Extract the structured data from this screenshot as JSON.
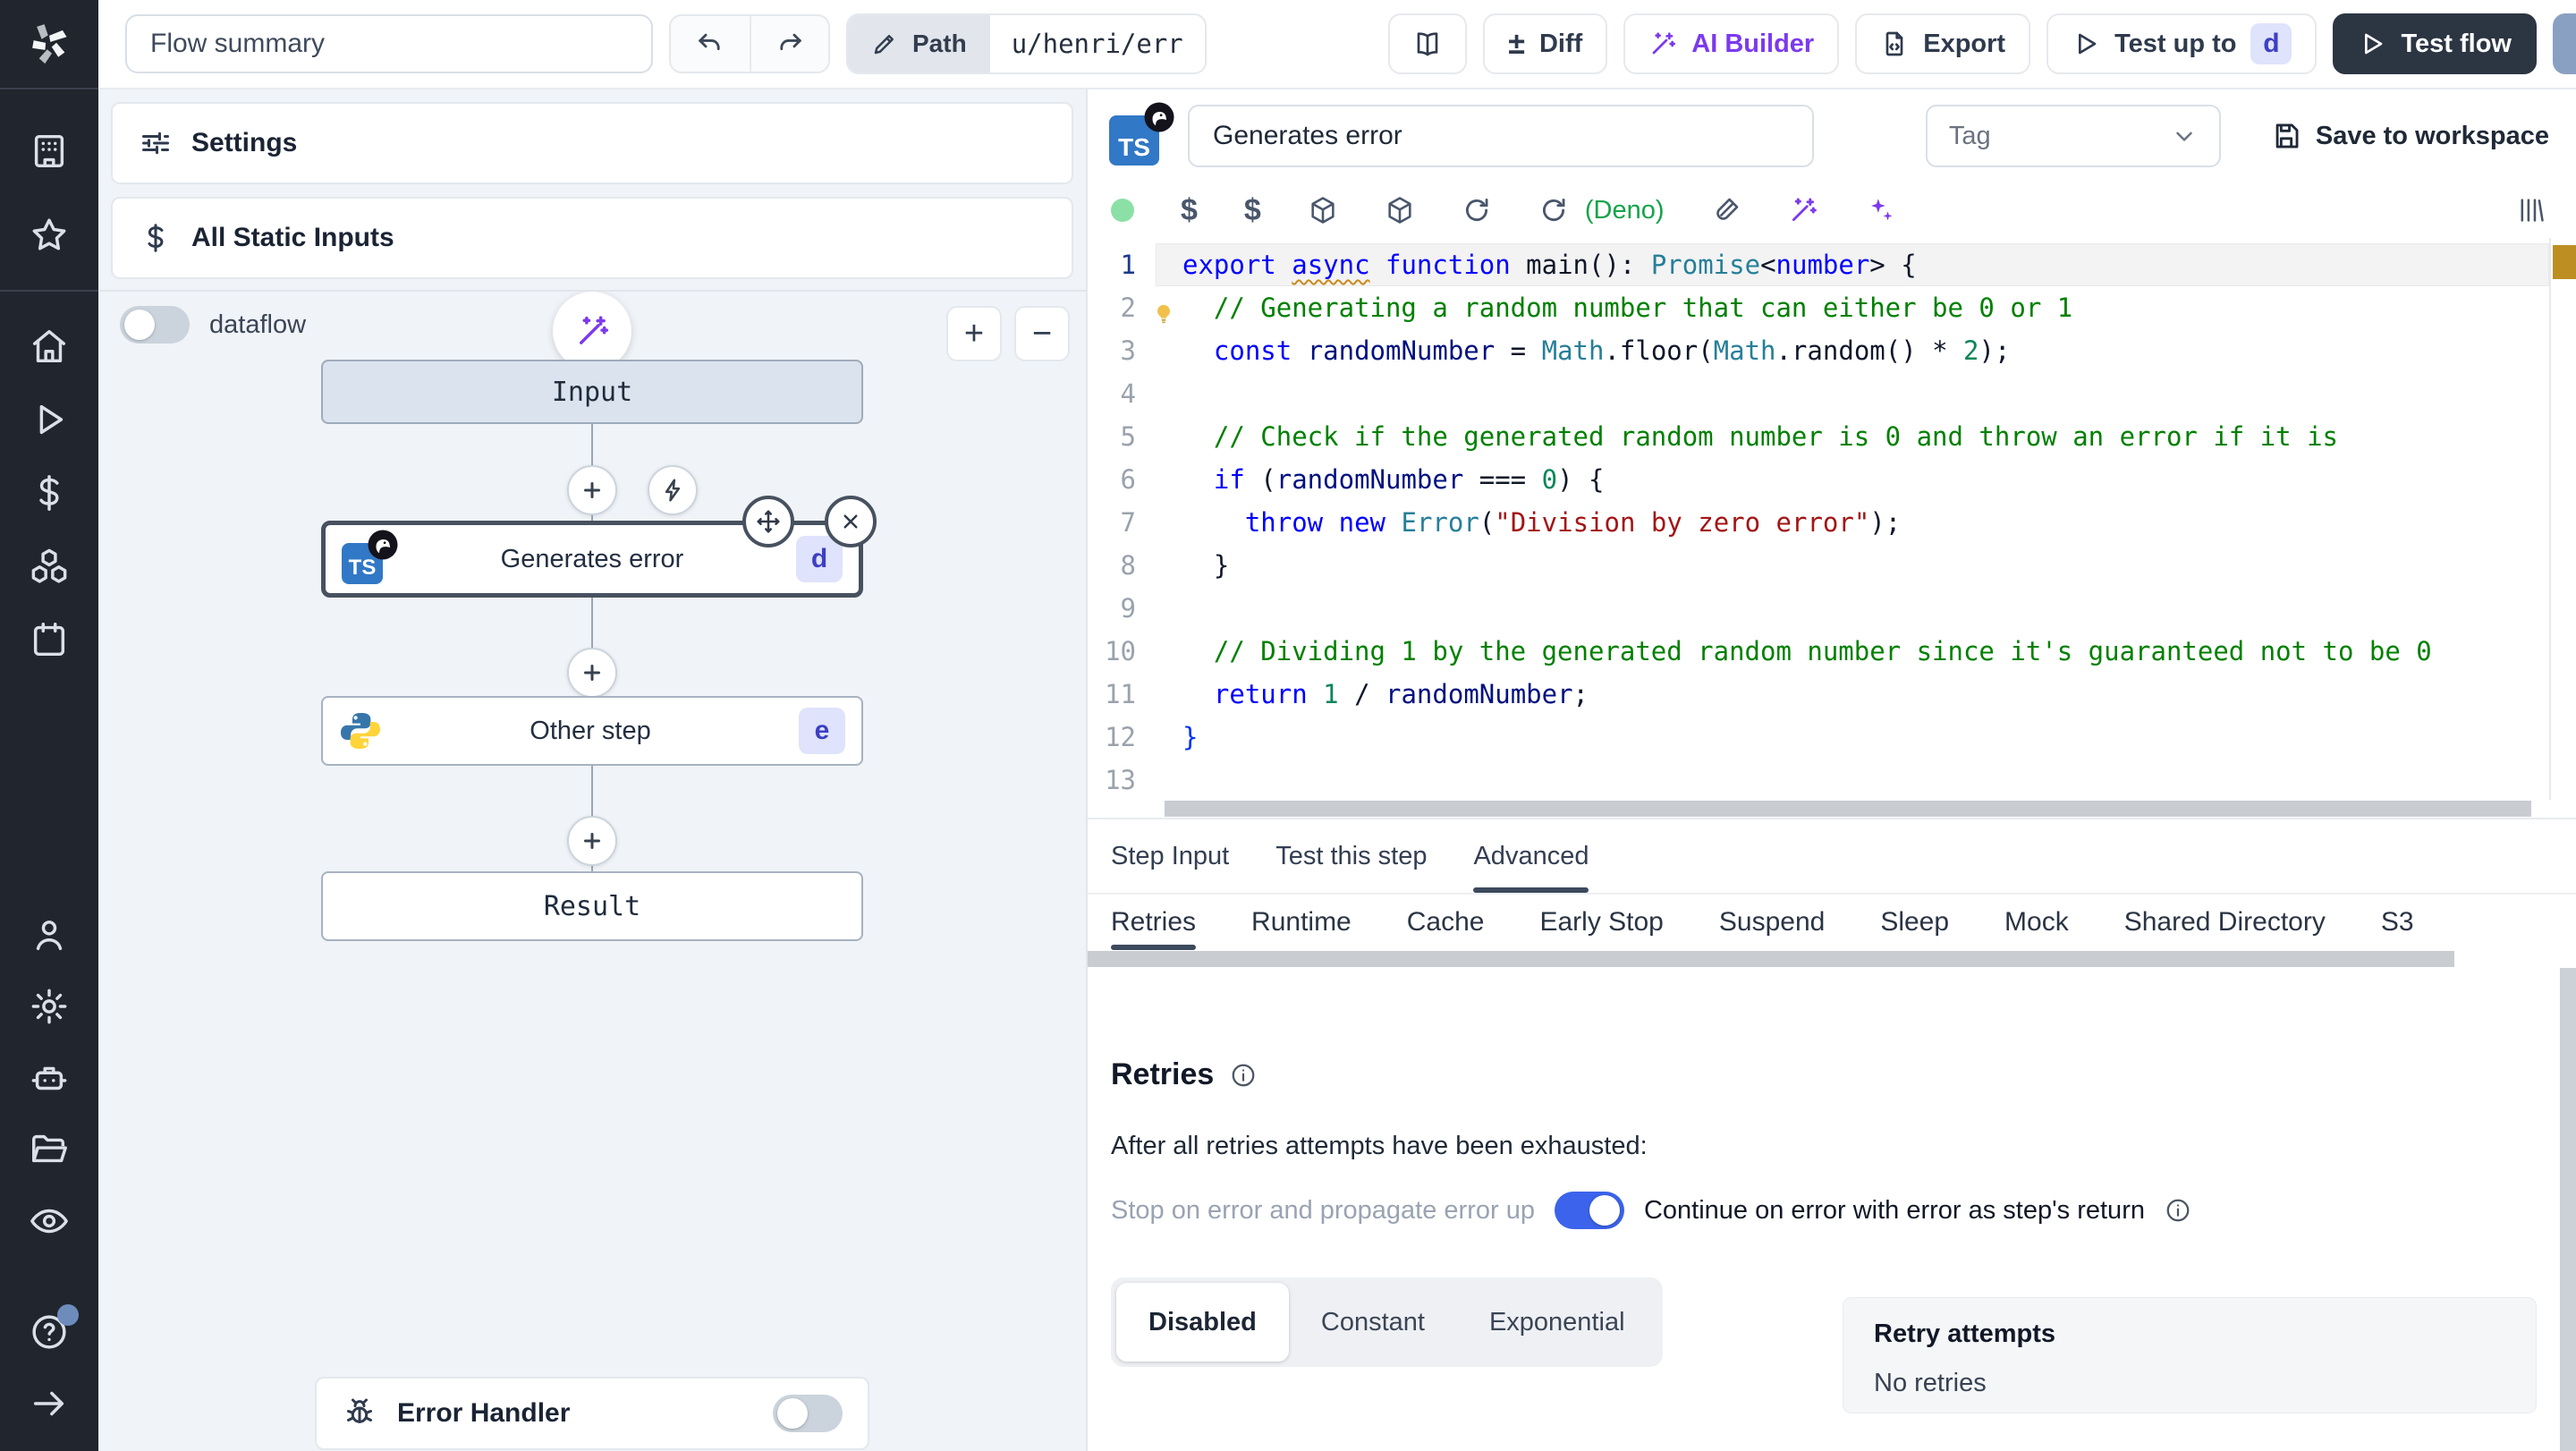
{
  "colors": {
    "accent_purple": "#7c3aed",
    "deno_green": "#15a34a",
    "toggle_on": "#3b63eb",
    "badge_bg": "#dfe3fb",
    "badge_text": "#3d3fc2"
  },
  "topbar": {
    "flow_summary": "Flow summary",
    "path_label": "Path",
    "path_value": "u/henri/err",
    "diff_label": "Diff",
    "ai_builder_label": "AI Builder",
    "export_label": "Export",
    "test_up_to_label": "Test up to",
    "test_up_to_badge": "d",
    "test_flow_label": "Test flow"
  },
  "flow": {
    "settings_label": "Settings",
    "static_inputs_label": "All Static Inputs",
    "dataflow_label": "dataflow",
    "zoom_in": "+",
    "zoom_out": "−",
    "input_label": "Input",
    "result_label": "Result",
    "step1_name": "Generates error",
    "step1_badge": "d",
    "step1_lang": "TS",
    "step2_name": "Other step",
    "step2_badge": "e",
    "error_handler_label": "Error Handler"
  },
  "editor": {
    "step_name": "Generates error",
    "ts_badge": "TS",
    "tag_placeholder": "Tag",
    "save_label": "Save to workspace",
    "deno_label": "(Deno)",
    "lines": [
      {
        "n": 1,
        "active": true,
        "tokens": [
          [
            "k",
            "export"
          ],
          [
            "d",
            " "
          ],
          [
            "k w",
            "async"
          ],
          [
            "d",
            " "
          ],
          [
            "k",
            "function"
          ],
          [
            "d",
            " main(): "
          ],
          [
            "t",
            "Promise"
          ],
          [
            "d",
            "<"
          ],
          [
            "k",
            "number"
          ],
          [
            "d",
            "> {"
          ]
        ]
      },
      {
        "n": 2,
        "bulb": true,
        "tokens": [
          [
            "d",
            "  "
          ],
          [
            "c",
            "// Generating a random number that can either be 0 or 1"
          ]
        ]
      },
      {
        "n": 3,
        "tokens": [
          [
            "d",
            "  "
          ],
          [
            "k",
            "const"
          ],
          [
            "d",
            " "
          ],
          [
            "v",
            "randomNumber"
          ],
          [
            "d",
            " = "
          ],
          [
            "t",
            "Math"
          ],
          [
            "d",
            ".floor("
          ],
          [
            "t",
            "Math"
          ],
          [
            "d",
            ".random() * "
          ],
          [
            "n",
            "2"
          ],
          [
            "d",
            ");"
          ]
        ]
      },
      {
        "n": 4,
        "tokens": []
      },
      {
        "n": 5,
        "tokens": [
          [
            "d",
            "  "
          ],
          [
            "c",
            "// Check if the generated random number is 0 and throw an error if it is"
          ]
        ]
      },
      {
        "n": 6,
        "tokens": [
          [
            "d",
            "  "
          ],
          [
            "k",
            "if"
          ],
          [
            "d",
            " ("
          ],
          [
            "v",
            "randomNumber"
          ],
          [
            "d",
            " === "
          ],
          [
            "n",
            "0"
          ],
          [
            "d",
            ") {"
          ]
        ]
      },
      {
        "n": 7,
        "tokens": [
          [
            "d",
            "    "
          ],
          [
            "k",
            "throw"
          ],
          [
            "d",
            " "
          ],
          [
            "k",
            "new"
          ],
          [
            "d",
            " "
          ],
          [
            "t",
            "Error"
          ],
          [
            "d",
            "("
          ],
          [
            "s",
            "\"Division by zero error\""
          ],
          [
            "d",
            ");"
          ]
        ]
      },
      {
        "n": 8,
        "tokens": [
          [
            "d",
            "  }"
          ]
        ]
      },
      {
        "n": 9,
        "tokens": []
      },
      {
        "n": 10,
        "tokens": [
          [
            "d",
            "  "
          ],
          [
            "c",
            "// Dividing 1 by the generated random number since it's guaranteed not to be 0"
          ]
        ]
      },
      {
        "n": 11,
        "tokens": [
          [
            "d",
            "  "
          ],
          [
            "k",
            "return"
          ],
          [
            "d",
            " "
          ],
          [
            "n",
            "1"
          ],
          [
            "d",
            " / "
          ],
          [
            "v",
            "randomNumber"
          ],
          [
            "d",
            ";"
          ]
        ]
      },
      {
        "n": 12,
        "tokens": [
          [
            "b",
            "}"
          ]
        ]
      },
      {
        "n": 13,
        "tokens": []
      }
    ]
  },
  "tabs": {
    "items": [
      {
        "label": "Step Input",
        "active": false
      },
      {
        "label": "Test this step",
        "active": false
      },
      {
        "label": "Advanced",
        "active": true
      }
    ]
  },
  "subtabs": {
    "items": [
      {
        "label": "Retries",
        "active": true
      },
      {
        "label": "Runtime",
        "active": false
      },
      {
        "label": "Cache",
        "active": false
      },
      {
        "label": "Early Stop",
        "active": false
      },
      {
        "label": "Suspend",
        "active": false
      },
      {
        "label": "Sleep",
        "active": false
      },
      {
        "label": "Mock",
        "active": false
      },
      {
        "label": "Shared Directory",
        "active": false
      },
      {
        "label": "S3",
        "active": false
      }
    ]
  },
  "retries": {
    "title": "Retries",
    "after_label": "After all retries attempts have been exhausted:",
    "stop_label": "Stop on error and propagate error up",
    "continue_label": "Continue on error with error as step's return",
    "modes": [
      {
        "label": "Disabled",
        "active": true
      },
      {
        "label": "Constant",
        "active": false
      },
      {
        "label": "Exponential",
        "active": false
      }
    ],
    "attempts_title": "Retry attempts",
    "attempts_value": "No retries"
  }
}
